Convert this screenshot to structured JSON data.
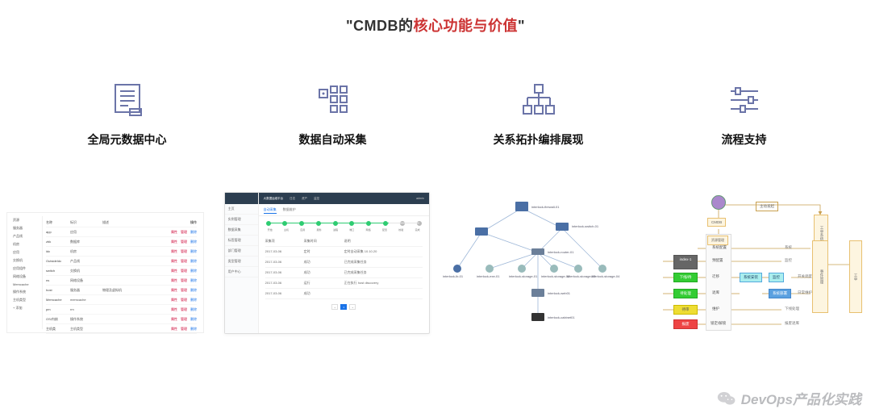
{
  "title": {
    "quoteOpen": "\"",
    "prefix": "CMDB的",
    "highlight": "核心功能与价值",
    "quoteClose": "\""
  },
  "features": [
    {
      "label": "全局元数据中心"
    },
    {
      "label": "数据自动采集"
    },
    {
      "label": "关系拓扑编排展现"
    },
    {
      "label": "流程支持"
    }
  ],
  "thumb1": {
    "sidemenu": [
      "资源",
      "服务器",
      "产品线",
      "机房",
      "应用",
      "交换机",
      "应用组件",
      "网络设备",
      "Memcache",
      "操作系统",
      "主机类型",
      "+ 添加"
    ],
    "headers": [
      "名称",
      "标识",
      "描述",
      "操作"
    ],
    "actions": [
      "属性",
      "管理",
      "删除"
    ],
    "rows": [
      {
        "c0": "app",
        "c1": "应用",
        "c2": ""
      },
      {
        "c0": "zbk",
        "c1": "数据库",
        "c2": ""
      },
      {
        "c0": "idc",
        "c1": "机房",
        "c2": ""
      },
      {
        "c0": "OutsideIdc",
        "c1": "产品线",
        "c2": ""
      },
      {
        "c0": "switch",
        "c1": "交换机",
        "c2": ""
      },
      {
        "c0": "ns",
        "c1": "网络设备",
        "c2": ""
      },
      {
        "c0": "host",
        "c1": "服务器",
        "c2": "物理及虚拟机"
      },
      {
        "c0": "Memcache",
        "c1": "memcache",
        "c2": ""
      },
      {
        "c0": "pm",
        "c1": "rm",
        "c2": ""
      },
      {
        "c0": "OS/内核",
        "c1": "操作系统",
        "c2": ""
      },
      {
        "c0": "主机类",
        "c1": "主机类型",
        "c2": ""
      }
    ]
  },
  "thumb2": {
    "topbar": {
      "title": "大数据运维平台",
      "items": [
        "日志",
        "资产",
        "监控"
      ],
      "user": "admin"
    },
    "sidemenu": [
      "主页",
      "实例管理",
      "数据采集",
      "标签管理",
      "部门管理",
      "类型管理",
      "用户中心"
    ],
    "tabs": [
      "自动采集",
      "数据维护"
    ],
    "steps": [
      "开始",
      "主机",
      "应用",
      "服务",
      "进程",
      "端口",
      "网络",
      "配置",
      "校验",
      "完成"
    ],
    "rows": [
      {
        "c0": "采集项",
        "c1": "采集时间",
        "c2": "说明"
      },
      {
        "c0": "2017-03-06",
        "c1": "定时",
        "c2": "定时自动采集 10.10.20"
      },
      {
        "c0": "2017-03-06",
        "c1": "成功",
        "c2": "已完成采集任务"
      },
      {
        "c0": "2017-03-06",
        "c1": "成功",
        "c2": "已完成采集任务"
      },
      {
        "c0": "2017-03-06",
        "c1": "运行",
        "c2": "正在执行 host discovery"
      },
      {
        "c0": "2017-03-06",
        "c1": "成功",
        "c2": ""
      }
    ],
    "pager": [
      "‹",
      "1",
      "›"
    ]
  },
  "thumb3": {
    "nodes": [
      "interlock-firewall-01",
      "interlock-switch-01",
      "interlock-router-01",
      "interlock-lb-01",
      "interlock-exe-01",
      "interlock-storage-01",
      "interlock-storage-02",
      "interlock-storage-03",
      "interlock-storage-04",
      "interlock-web01",
      "interlock-cabinet01"
    ]
  },
  "thumb4": {
    "labels": {
      "top": "主动发起"
    },
    "boxes": {
      "cmdb": "CMDB",
      "resmgmt": "资源管理",
      "workorder": "工单系统",
      "event": "事件管理",
      "right2": "工单"
    },
    "states": [
      "index-1",
      "下线/待",
      "待处理",
      "待审",
      "报废"
    ],
    "ops": [
      "系统配置",
      "预配置",
      "迁移",
      "退库",
      "维护",
      "锁定/解锁"
    ],
    "mid": [
      "系统安装",
      "监控",
      "系统部署"
    ],
    "right": [
      "系统",
      "监控",
      "开关调度",
      "日常维护",
      "下线处理",
      "报废退库"
    ]
  },
  "watermark": "DevOps产品化实践"
}
